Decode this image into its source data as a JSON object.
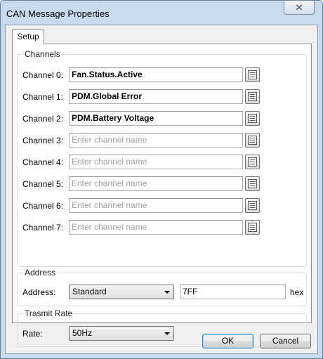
{
  "window": {
    "title": "CAN Message Properties"
  },
  "tabs": [
    {
      "label": "Setup"
    }
  ],
  "channels": {
    "group_title": "Channels",
    "rows": [
      {
        "label": "Channel 0:",
        "value": "Fan.Status.Active",
        "placeholder": ""
      },
      {
        "label": "Channel 1:",
        "value": "PDM.Global Error",
        "placeholder": ""
      },
      {
        "label": "Channel 2:",
        "value": "PDM.Battery Voltage",
        "placeholder": ""
      },
      {
        "label": "Channel 3:",
        "value": "",
        "placeholder": "Enter channel name"
      },
      {
        "label": "Channel 4:",
        "value": "",
        "placeholder": "Enter channel name"
      },
      {
        "label": "Channel 5:",
        "value": "",
        "placeholder": "Enter channel name"
      },
      {
        "label": "Channel 6:",
        "value": "",
        "placeholder": "Enter channel name"
      },
      {
        "label": "Channel 7:",
        "value": "",
        "placeholder": "Enter channel name"
      }
    ]
  },
  "address": {
    "group_title": "Address",
    "label": "Address:",
    "type_selected": "Standard",
    "value": "7FF",
    "suffix": "hex"
  },
  "transmit": {
    "group_title": "Trasmit Rate",
    "label": "Rate:",
    "rate_selected": "50Hz"
  },
  "buttons": {
    "ok": "OK",
    "cancel": "Cancel"
  },
  "icons": {
    "close": "close-icon",
    "browse": "list-icon",
    "dropdown": "chevron-down-icon"
  }
}
